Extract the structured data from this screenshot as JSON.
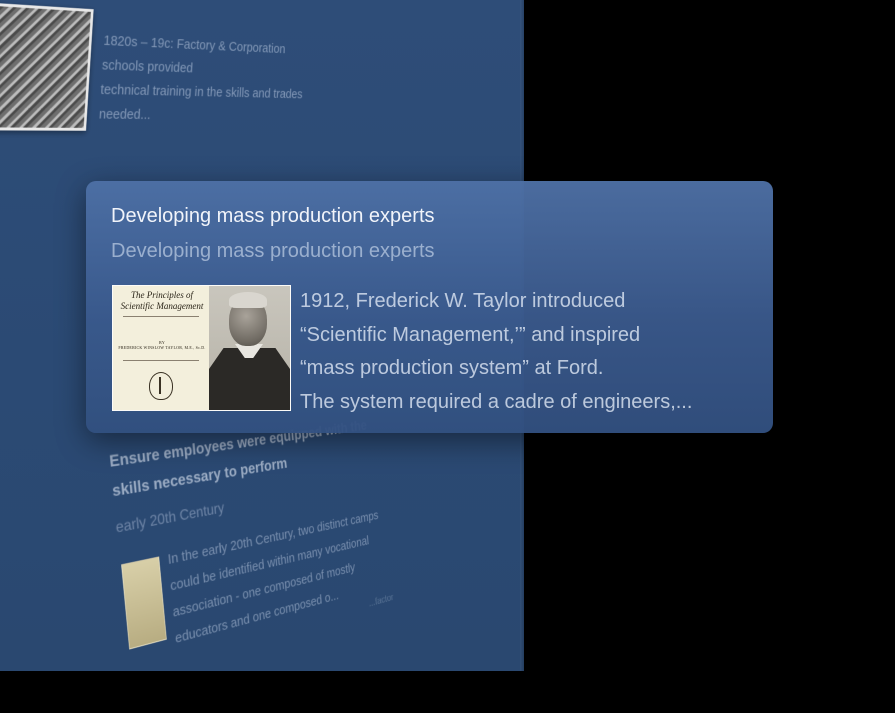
{
  "colors": {
    "background": "#000000",
    "panel": "#2d4c77",
    "focus_card": "#46699f",
    "focus_title": "#f1f4fa"
  },
  "top_card": {
    "lines": [
      "1820s – 19c: Factory & Corporation",
      "schools provided",
      "technical training in the skills and trades",
      "needed..."
    ]
  },
  "focus_card": {
    "title": "Developing mass production experts",
    "subtitle": "Developing mass production experts",
    "image": {
      "book_title_line1": "The Principles of",
      "book_title_line2": "Scientific Management",
      "book_by": "BY",
      "book_author": "FREDERICK WINSLOW TAYLOR, M.E., Sc.D."
    },
    "body_lines": [
      "1912, Frederick W. Taylor introduced",
      "“Scientific Management,’” and inspired",
      "“mass production system” at Ford.",
      "The system required a cadre of engineers,..."
    ]
  },
  "bottom_card": {
    "headline": "Ensure employees were equipped with the skills necessary to perform",
    "subtitle": "early 20th Century",
    "body": "In the early 20th Century, two distinct camps could be identified within many vocational association - one composed of mostly educators and one composed o...",
    "faint": "...factor"
  }
}
